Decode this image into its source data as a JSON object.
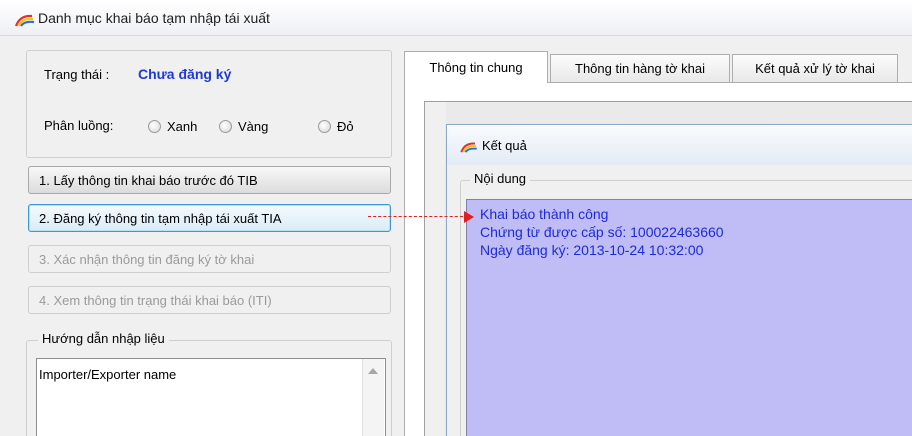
{
  "window": {
    "title": "Danh mục khai báo tạm nhập tái xuất",
    "icon": "rainbow-arc-icon"
  },
  "status": {
    "label": "Trạng thái :",
    "value": "Chưa đăng ký",
    "value_color": "#1e3ad8"
  },
  "lane": {
    "label": "Phân luồng:",
    "options": [
      "Xanh",
      "Vàng",
      "Đỏ"
    ]
  },
  "steps": [
    {
      "label": "1. Lấy thông tin khai báo trước đó TIB",
      "enabled": true
    },
    {
      "label": "2. Đăng ký thông tin tạm nhập tái xuất TIA",
      "enabled": true,
      "focused": true
    },
    {
      "label": "3. Xác nhận thông tin đăng ký tờ khai",
      "enabled": false
    },
    {
      "label": "4. Xem thông tin trạng thái khai báo (ITI)",
      "enabled": false
    }
  ],
  "guide": {
    "legend": "Hướng dẫn nhập liệu",
    "content": "Importer/Exporter name"
  },
  "tabs": [
    {
      "label": "Thông tin chung",
      "selected": true
    },
    {
      "label": "Thông tin hàng tờ khai",
      "selected": false
    },
    {
      "label": "Kết quả xử lý tờ khai",
      "selected": false
    }
  ],
  "result_dialog": {
    "title": "Kết quả",
    "legend": "Nội dung",
    "lines": [
      "Khai báo thành công",
      "Chứng từ được cấp số: 100022463660",
      "Ngày đăng ký: 2013-10-24 10:32:00"
    ],
    "text_color": "#1b2cd6",
    "background": "#bfbcf6"
  },
  "annotation": {
    "arrow_color": "#e02020"
  }
}
